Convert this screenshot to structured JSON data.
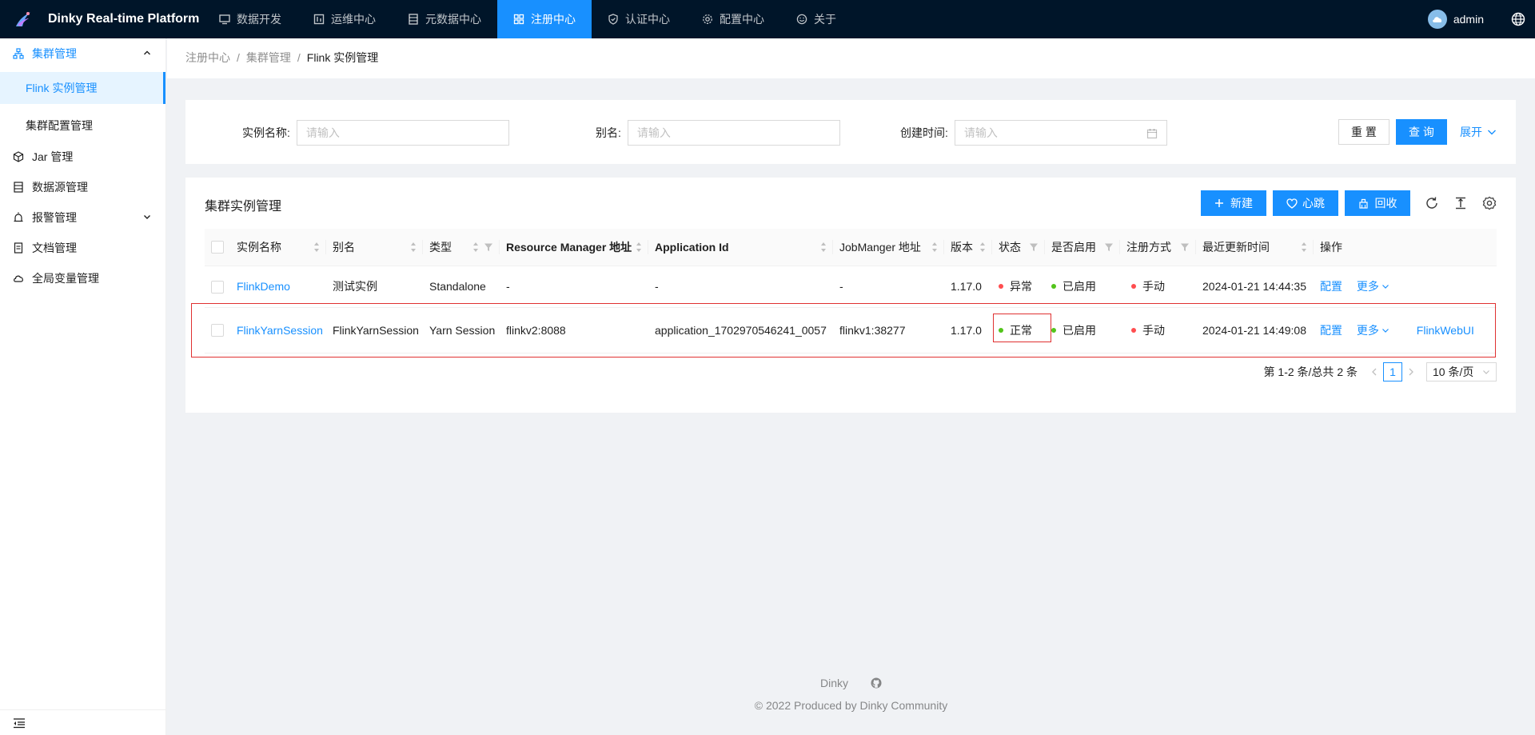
{
  "app": {
    "title": "Dinky Real-time Platform"
  },
  "topnav": [
    {
      "label": "数据开发",
      "icon": "monitor-icon"
    },
    {
      "label": "运维中心",
      "icon": "dashboard-icon"
    },
    {
      "label": "元数据中心",
      "icon": "database-icon"
    },
    {
      "label": "注册中心",
      "icon": "appstore-icon",
      "active": true
    },
    {
      "label": "认证中心",
      "icon": "safety-icon"
    },
    {
      "label": "配置中心",
      "icon": "setting-icon"
    },
    {
      "label": "关于",
      "icon": "smile-icon"
    }
  ],
  "user": {
    "name": "admin"
  },
  "sidebar": {
    "group_open": {
      "label": "集群管理",
      "icon": "cluster-icon"
    },
    "sub_items": [
      {
        "label": "Flink 实例管理",
        "active": true
      },
      {
        "label": "集群配置管理"
      }
    ],
    "items": [
      {
        "label": "Jar 管理",
        "icon": "code-sandbox-icon"
      },
      {
        "label": "数据源管理",
        "icon": "table-icon"
      },
      {
        "label": "报警管理",
        "icon": "alert-icon",
        "has_arrow": true
      },
      {
        "label": "文档管理",
        "icon": "file-icon"
      },
      {
        "label": "全局变量管理",
        "icon": "cloud-icon"
      }
    ]
  },
  "breadcrumb": [
    "注册中心",
    "集群管理",
    "Flink 实例管理"
  ],
  "breadcrumb_sep": "/",
  "search": {
    "fields": [
      {
        "label": "实例名称:",
        "placeholder": "请输入"
      },
      {
        "label": "别名:",
        "placeholder": "请输入"
      },
      {
        "label": "创建时间:",
        "placeholder": "请输入"
      }
    ],
    "reset_label": "重 置",
    "query_label": "查 询",
    "expand_label": "展开"
  },
  "table": {
    "title": "集群实例管理",
    "toolbar": {
      "new_label": "新建",
      "heartbeat_label": "心跳",
      "recycle_label": "回收"
    },
    "columns": [
      "实例名称",
      "别名",
      "类型",
      "Resource Manager 地址",
      "Application Id",
      "JobManger 地址",
      "版本",
      "状态",
      "是否启用",
      "注册方式",
      "最近更新时间",
      "操作"
    ],
    "rows": [
      {
        "name": "FlinkDemo",
        "alias": "测试实例",
        "type": "Standalone",
        "rm": "-",
        "app_id": "-",
        "jm": "-",
        "version": "1.17.0",
        "status": "异常",
        "enabled": "已启用",
        "reg": "手动",
        "updated": "2024-01-21 14:44:35",
        "op_config": "配置",
        "op_more": "更多",
        "op_web": ""
      },
      {
        "name": "FlinkYarnSession",
        "alias": "FlinkYarnSession",
        "type": "Yarn Session",
        "rm": "flinkv2:8088",
        "app_id": "application_1702970546241_0057",
        "jm": "flinkv1:38277",
        "version": "1.17.0",
        "status": "正常",
        "enabled": "已启用",
        "reg": "手动",
        "updated": "2024-01-21 14:49:08",
        "op_config": "配置",
        "op_more": "更多",
        "op_web": "FlinkWebUI"
      }
    ]
  },
  "pagination": {
    "total_text": "第 1-2 条/总共 2 条",
    "current": "1",
    "page_size": "10 条/页"
  },
  "footer": {
    "brand": "Dinky",
    "copyright": "© 2022 Produced by Dinky Community"
  },
  "colors": {
    "header_bg": "#001529",
    "primary": "#1890ff",
    "error": "#ff4d4f",
    "success": "#52c41a",
    "highlight": "#e03131"
  }
}
